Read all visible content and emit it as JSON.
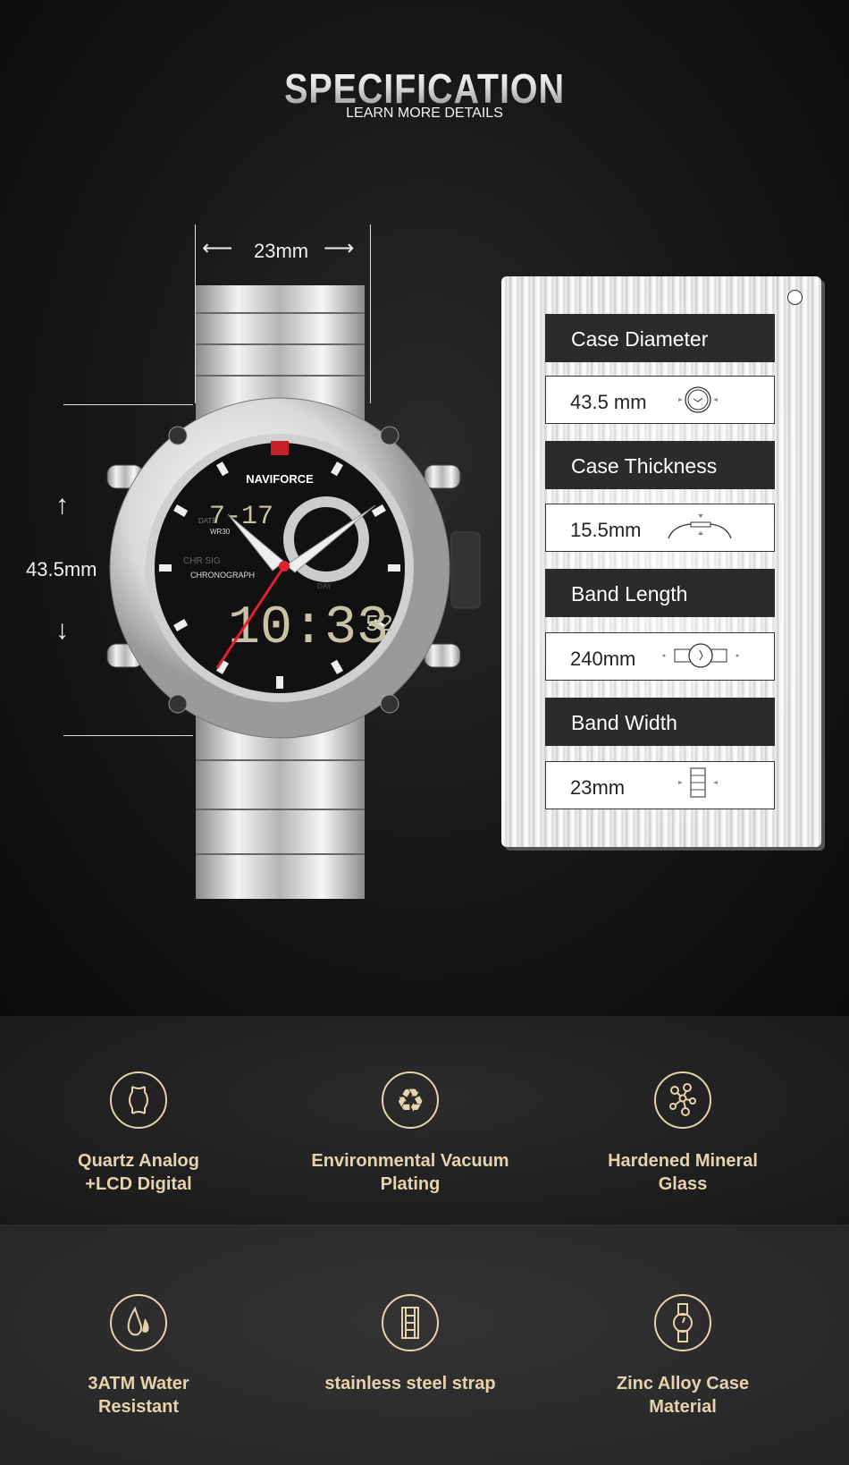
{
  "header": {
    "title": "SPECIFICATION",
    "subtitle": "LEARN MORE DETAILS"
  },
  "watch": {
    "brand": "NAVIFORCE",
    "dial_labels": [
      "DATE",
      "WR30",
      "CHR SIG",
      "CHRONOGRAPH",
      "DAY"
    ],
    "lcd_top": "7-17",
    "lcd_main": "10:33",
    "lcd_seconds": "52",
    "band_width_label": "23mm",
    "case_height_label": "43.5mm"
  },
  "specs": [
    {
      "label": "Case Diameter",
      "value": "43.5 mm",
      "icon": "watch-face-icon"
    },
    {
      "label": "Case Thickness",
      "value": "15.5mm",
      "icon": "watch-side-icon"
    },
    {
      "label": "Band Length",
      "value": "240mm",
      "icon": "watch-band-icon"
    },
    {
      "label": "Band Width",
      "value": "23mm",
      "icon": "band-link-icon"
    }
  ],
  "features": [
    {
      "line1": "Quartz Analog",
      "line2": "+LCD Digital",
      "icon": "watch-outline-icon"
    },
    {
      "line1": "Environmental Vacuum",
      "line2": "Plating",
      "icon": "recycle-icon"
    },
    {
      "line1": "Hardened Mineral",
      "line2": "Glass",
      "icon": "molecule-icon"
    },
    {
      "line1": "3ATM Water",
      "line2": "Resistant",
      "icon": "water-drop-icon"
    },
    {
      "line1": "stainless steel strap",
      "line2": "",
      "icon": "strap-icon"
    },
    {
      "line1": "Zinc Alloy Case",
      "line2": "Material",
      "icon": "wristwatch-icon"
    }
  ],
  "colors": {
    "gold": "#e6d3ad",
    "panel_header": "#2b2b2b",
    "hand_red": "#e0202a"
  }
}
